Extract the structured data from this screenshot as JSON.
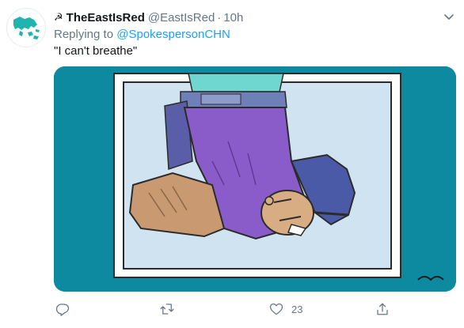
{
  "tweet": {
    "display_name": "TheEastIsRed",
    "name_prefix_icon": "hammer-sickle-icon",
    "handle": "@EastIsRed",
    "separator": "·",
    "time": "10h",
    "replying_to_label": "Replying to",
    "replying_to_handle": "@SpokespersonCHN",
    "text": "\"I can't breathe\""
  },
  "media": {
    "alt": "Cartoon: a police officer's knee pressing down on a man's neck",
    "background_color": "#0d8aa0"
  },
  "actions": {
    "reply": {
      "icon": "reply-icon",
      "count": ""
    },
    "retweet": {
      "icon": "retweet-icon",
      "count": ""
    },
    "like": {
      "icon": "heart-icon",
      "count": "23"
    },
    "share": {
      "icon": "share-icon",
      "count": ""
    }
  },
  "colors": {
    "text_primary": "#14171a",
    "text_secondary": "#657786",
    "link": "#1da1f2"
  }
}
